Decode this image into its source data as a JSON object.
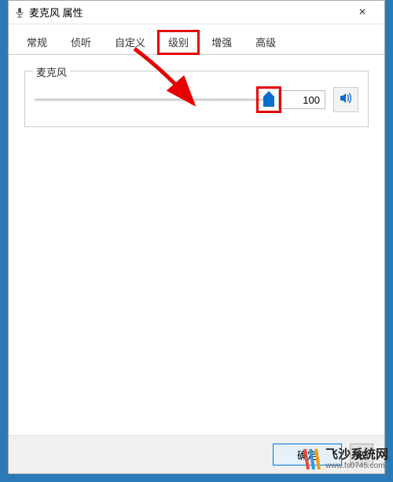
{
  "window": {
    "title": "麦克风 属性",
    "close_label": "×"
  },
  "tabs": {
    "items": [
      {
        "label": "常规"
      },
      {
        "label": "侦听"
      },
      {
        "label": "自定义"
      },
      {
        "label": "级别",
        "active": true,
        "highlighted": true
      },
      {
        "label": "增强"
      },
      {
        "label": "高级"
      }
    ]
  },
  "slider": {
    "group_label": "麦克风",
    "value": "100",
    "percent": 100,
    "mute_icon": "speaker-icon"
  },
  "buttons": {
    "ok": "确定",
    "cancel": "取"
  },
  "watermark": {
    "name": "飞沙系统网",
    "url": "www.fs0745.com"
  },
  "annotations": {
    "highlight_tab_index": 3,
    "highlight_thumb": true,
    "arrow": true
  }
}
